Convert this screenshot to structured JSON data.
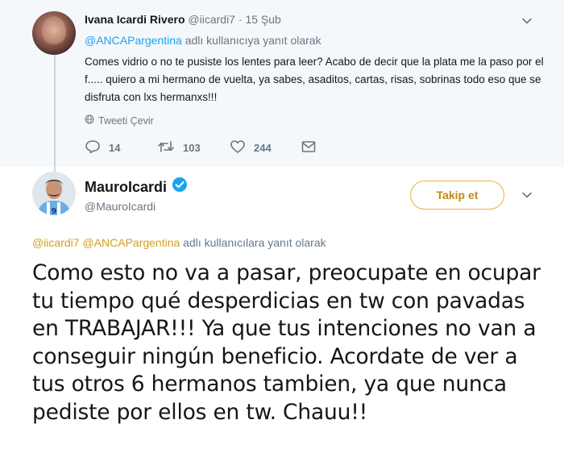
{
  "reply_tweet": {
    "author_name": "Ivana Icardi Rivero",
    "author_handle": "@iicardi7",
    "separator": "·",
    "timestamp": "15 Şub",
    "reply_to_mention": "@ANCAPargentina",
    "reply_to_suffix": " adlı kullanıcıya yanıt olarak",
    "text": "Comes vidrio o no te pusiste los lentes para leer? Acabo de decir que la plata me la paso por el f..... quiero a mi hermano de vuelta, ya sabes, asaditos, cartas, risas, sobrinas todo eso que se disfruta con lxs hermanxs!!!",
    "translate_label": "Tweeti Çevir",
    "reply_count": "14",
    "retweet_count": "103",
    "like_count": "244"
  },
  "main_tweet": {
    "author_name": "MauroIcardi",
    "author_handle": "@MauroIcardi",
    "follow_label": "Takip et",
    "reply_to_mention_1": "@iicardi7",
    "reply_to_mention_2": "@ANCAPargentina",
    "reply_to_suffix": " adlı kullanıcılara yanıt olarak",
    "text": "Como esto no va a pasar, preocupate en ocupar tu tiempo qué desperdicias en tw con pavadas en TRABAJAR!!! Ya que tus intenciones no van a conseguir ningún beneficio. Acordate de ver a tus otros 6 hermanos tambien, ya que nunca pediste por ellos en tw. Chauu!!"
  },
  "icons": {
    "menu": "chevron-down-icon",
    "translate": "globe-icon",
    "reply": "reply-icon",
    "retweet": "retweet-icon",
    "like": "heart-icon",
    "dm": "envelope-icon",
    "verified": "verified-badge-icon"
  },
  "colors": {
    "reply_background": "#f5f8fa",
    "mention_blue": "#1da1f2",
    "mention_gold": "#d4a017",
    "follow_border": "#e9b23f",
    "verified_blue": "#1da1f2",
    "muted": "#657786"
  }
}
